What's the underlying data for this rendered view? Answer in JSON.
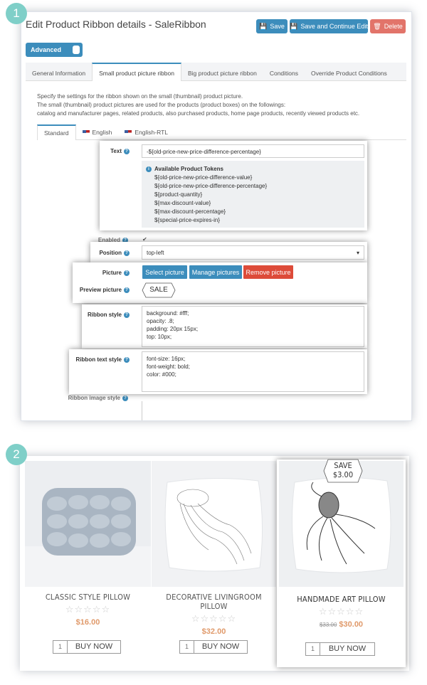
{
  "badges": {
    "one": "1",
    "two": "2"
  },
  "editor": {
    "title": "Edit Product Ribbon details - SaleRibbon",
    "buttons": {
      "save": "Save",
      "save_continue": "Save and Continue Edit",
      "delete": "Delete"
    },
    "advanced": "Advanced",
    "tabs": [
      "General Information",
      "Small product picture ribbon",
      "Big product picture ribbon",
      "Conditions",
      "Override Product Conditions"
    ],
    "description": [
      "Specify the settings for the ribbon shown on the small (thumbnail) product picture.",
      "The small (thumbnail) product pictures are used for the products (product boxes) on the followings:",
      "catalog and manufacturer pages, related products, also purchased products, home page products, recently viewed products etc."
    ],
    "lang_tabs": [
      "Standard",
      "English",
      "English-RTL"
    ],
    "fields": {
      "text_label": "Text",
      "text_value": "-${old-price-new-price-difference-percentage}",
      "tokens_title": "Available Product Tokens",
      "tokens": [
        "${old-price-new-price-difference-value}",
        "${old-price-new-price-difference-percentage}",
        "${product-quantity}",
        "${max-discount-value}",
        "${max-discount-percentage}",
        "${special-price-expires-in}"
      ],
      "enabled_label": "Enabled",
      "position_label": "Position",
      "position_value": "top-left",
      "picture_label": "Picture",
      "select_picture": "Select picture",
      "manage_pictures": "Manage pictures",
      "remove_picture": "Remove picture",
      "preview_label": "Preview picture",
      "preview_text": "SALE",
      "ribbon_style_label": "Ribbon style",
      "ribbon_style": [
        "background: #fff;",
        "opacity: .8;",
        "padding: 20px 15px;",
        "top: 10px;"
      ],
      "ribbon_text_label": "Ribbon text style",
      "ribbon_text_style": [
        "font-size: 16px;",
        "font-weight: bold;",
        "color: #000;"
      ],
      "ribbon_image_label": "Ribbon image style"
    }
  },
  "products": [
    {
      "name": "CLASSIC STYLE PILLOW",
      "price": "$16.00",
      "qty": "1",
      "buy": "BUY NOW"
    },
    {
      "name": "DECORATIVE LIVINGROOM PILLOW",
      "price": "$32.00",
      "qty": "1",
      "buy": "BUY NOW"
    },
    {
      "name": "HANDMADE ART PILLOW",
      "old_price": "$33.00",
      "price": "$30.00",
      "qty": "1",
      "buy": "BUY NOW",
      "ribbon_line1": "SAVE",
      "ribbon_line2": "$3.00"
    }
  ],
  "colors": {
    "accent": "#3c8dbc",
    "danger": "#e2746a",
    "badge": "#7fcfc8",
    "price": "#e09a6b"
  }
}
